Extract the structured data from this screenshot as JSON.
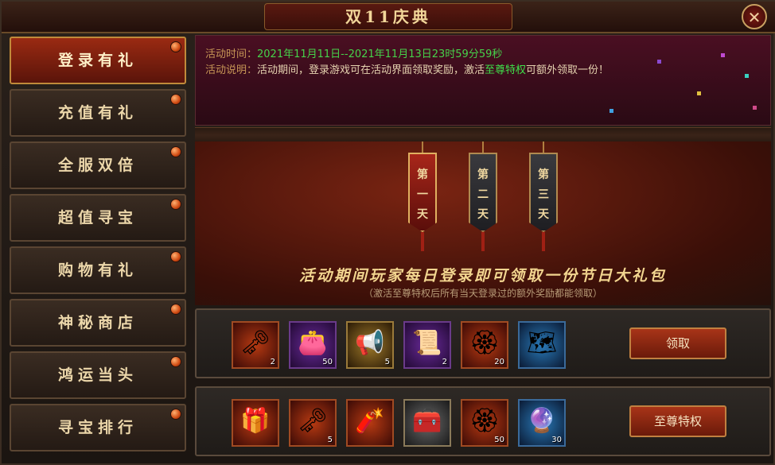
{
  "title": "双11庆典",
  "close_glyph": "✕",
  "sidebar": {
    "items": [
      {
        "label": "登录有礼",
        "active": true
      },
      {
        "label": "充值有礼",
        "active": false
      },
      {
        "label": "全服双倍",
        "active": false
      },
      {
        "label": "超值寻宝",
        "active": false
      },
      {
        "label": "购物有礼",
        "active": false
      },
      {
        "label": "神秘商店",
        "active": false
      },
      {
        "label": "鸿运当头",
        "active": false
      },
      {
        "label": "寻宝排行",
        "active": false
      }
    ]
  },
  "info": {
    "time_label": "活动时间：",
    "time_value": "2021年11月11日--2021年11月13日23时59分59秒",
    "desc_label": "活动说明：",
    "desc_before": "活动期间，登录游戏可在活动界面领取奖励，激活",
    "desc_highlight": "至尊特权",
    "desc_after": "可额外领取一份！"
  },
  "days": [
    {
      "label": "第一天",
      "chars": [
        "第",
        "一",
        "天"
      ],
      "active": true
    },
    {
      "label": "第二天",
      "chars": [
        "第",
        "二",
        "天"
      ],
      "active": false
    },
    {
      "label": "第三天",
      "chars": [
        "第",
        "三",
        "天"
      ],
      "active": false
    }
  ],
  "headline": "活动期间玩家每日登录即可领取一份节日大礼包",
  "subline": "（激活至尊特权后所有当天登录过的额外奖励都能领取）",
  "reward_rows": [
    {
      "button_label": "领取",
      "items": [
        {
          "icon": "golden-key-icon",
          "glyph": "🗝",
          "count": "2",
          "style": "red"
        },
        {
          "icon": "purple-bag-icon",
          "glyph": "👛",
          "count": "50",
          "style": "purple"
        },
        {
          "icon": "horn-icon",
          "glyph": "📢",
          "count": "5",
          "style": "gold"
        },
        {
          "icon": "scroll-icon",
          "glyph": "📜",
          "count": "2",
          "style": "purple"
        },
        {
          "icon": "red-token-icon",
          "glyph": "🏵",
          "count": "20",
          "style": "red"
        },
        {
          "icon": "blue-scroll-icon",
          "glyph": "🗺",
          "count": "",
          "style": "blue"
        }
      ]
    },
    {
      "button_label": "至尊特权",
      "items": [
        {
          "icon": "treasure-chest-icon",
          "glyph": "🎁",
          "count": "",
          "style": "red"
        },
        {
          "icon": "golden-key-icon",
          "glyph": "🗝",
          "count": "5",
          "style": "red"
        },
        {
          "icon": "red-roll-icon",
          "glyph": "🧨",
          "count": "",
          "style": "red"
        },
        {
          "icon": "silver-chest-icon",
          "glyph": "🧰",
          "count": "",
          "style": "gray"
        },
        {
          "icon": "red-token-icon",
          "glyph": "🏵",
          "count": "50",
          "style": "red"
        },
        {
          "icon": "blue-orb-icon",
          "glyph": "🔮",
          "count": "30",
          "style": "blue"
        }
      ]
    }
  ]
}
